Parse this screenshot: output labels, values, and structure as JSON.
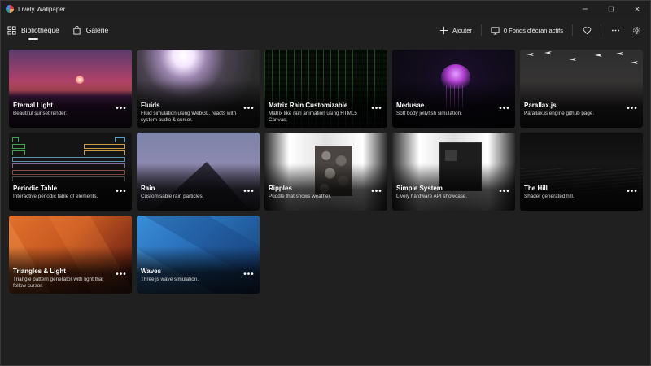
{
  "window": {
    "title": "Lively Wallpaper",
    "controls": [
      "minimize",
      "maximize",
      "close"
    ]
  },
  "nav": {
    "library_label": "Bibliothèque",
    "gallery_label": "Galerie"
  },
  "toolbar": {
    "add_label": "Ajouter",
    "active_label": "0 Fonds d'écran actifs"
  },
  "wallpapers": [
    {
      "title": "Eternal Light",
      "description": "Beautiful sunset render."
    },
    {
      "title": "Fluids",
      "description": "Fluid simulation using WebGL, reacts with system audio & cursor."
    },
    {
      "title": "Matrix Rain Customizable",
      "description": "Matrix like rain animation using HTML5 Canvas."
    },
    {
      "title": "Medusae",
      "description": "Soft body jellyfish simulation."
    },
    {
      "title": "Parallax.js",
      "description": "Parallax.js engine github page."
    },
    {
      "title": "Periodic Table",
      "description": "Interactive periodic table of elements."
    },
    {
      "title": "Rain",
      "description": "Customisable rain particles."
    },
    {
      "title": "Ripples",
      "description": "Puddle that shows weather."
    },
    {
      "title": "Simple System",
      "description": "Lively hardware API showcase."
    },
    {
      "title": "The Hill",
      "description": "Shader generated hill."
    },
    {
      "title": "Triangles & Light",
      "description": "Triangle pattern generator with light that follow cursor."
    },
    {
      "title": "Waves",
      "description": "Three.js wave simulation."
    }
  ],
  "more_glyph": "•••",
  "colors": {
    "background": "#202020",
    "titlebar": "#1f1f1f",
    "text": "#ffffff"
  }
}
